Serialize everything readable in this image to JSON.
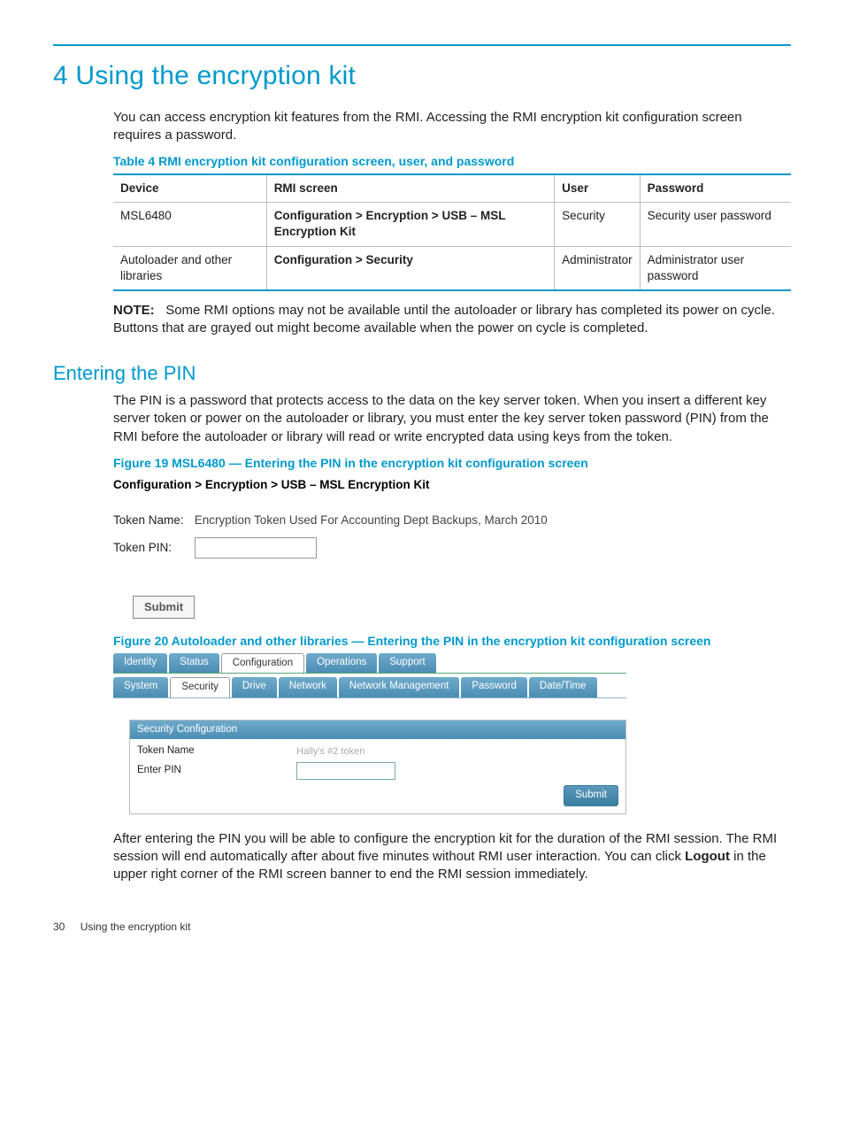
{
  "chapter_title": "4 Using the encryption kit",
  "intro": "You can access encryption kit features from the RMI. Accessing the RMI encryption kit configuration screen requires a password.",
  "table4": {
    "title": "Table 4 RMI encryption kit configuration screen, user, and password",
    "headers": [
      "Device",
      "RMI screen",
      "User",
      "Password"
    ],
    "rows": [
      {
        "device": "MSL6480",
        "screen": "Configuration > Encryption > USB – MSL Encryption Kit",
        "user": "Security",
        "password": "Security user password"
      },
      {
        "device": "Autoloader and other libraries",
        "screen": "Configuration > Security",
        "user": "Administrator",
        "password": "Administrator user password"
      }
    ]
  },
  "note_label": "NOTE:",
  "note_text": "Some RMI options may not be available until the autoloader or library has completed its power on cycle. Buttons that are grayed out might become available when the power on cycle is completed.",
  "section_title": "Entering the PIN",
  "pin_para": "The PIN is a password that protects access to the data on the key server token. When you insert a different key server token or power on the autoloader or library, you must enter the key server token password (PIN) from the RMI before the autoloader or library will read or write encrypted data using keys from the token.",
  "fig19": {
    "title": "Figure 19 MSL6480 — Entering the PIN in the encryption kit configuration screen",
    "breadcrumb": "Configuration > Encryption > USB – MSL Encryption Kit",
    "token_name_label": "Token Name:",
    "token_name_value": "Encryption Token Used For Accounting Dept Backups, March 2010",
    "token_pin_label": "Token PIN:",
    "submit": "Submit"
  },
  "fig20": {
    "title": "Figure 20 Autoloader and other libraries — Entering the PIN in the encryption kit configuration screen",
    "tabs1": [
      "Identity",
      "Status",
      "Configuration",
      "Operations",
      "Support"
    ],
    "active1": "Configuration",
    "tabs2": [
      "System",
      "Security",
      "Drive",
      "Network",
      "Network Management",
      "Password",
      "Date/Time"
    ],
    "active2": "Security",
    "box_title": "Security Configuration",
    "token_name_label": "Token Name",
    "token_name_value": "Hally's #2 token",
    "enter_pin_label": "Enter PIN",
    "submit": "Submit"
  },
  "after_pin_1": "After entering the PIN you will be able to configure the encryption kit for the duration of the RMI session. The RMI session will end automatically after about five minutes without RMI user interaction. You can click ",
  "logout_bold": "Logout",
  "after_pin_2": " in the upper right corner of the RMI screen banner to end the RMI session immediately.",
  "footer": {
    "page": "30",
    "title": "Using the encryption kit"
  }
}
